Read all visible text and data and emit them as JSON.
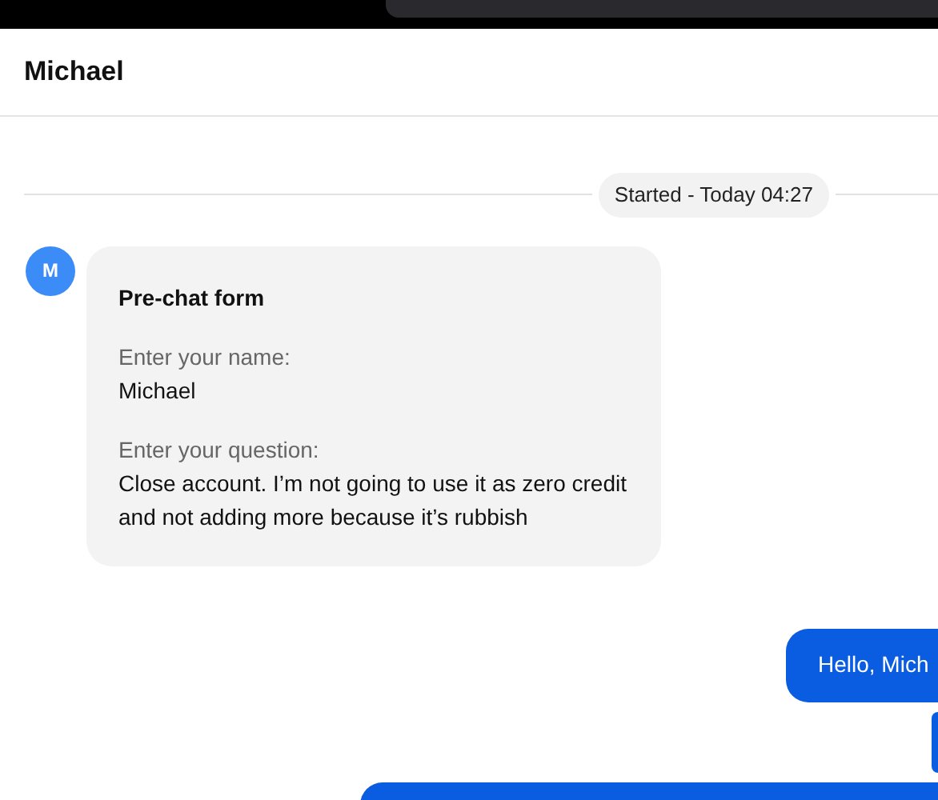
{
  "top_bar": {
    "search": {
      "kind": "field"
    }
  },
  "header": {
    "title": "Michael"
  },
  "separator": {
    "label": "Started - Today 04:27"
  },
  "messages": [
    {
      "kind": "form",
      "avatar": "M",
      "title": "Pre-chat form",
      "fields": [
        {
          "label": "Enter your name:",
          "value": "Michael"
        },
        {
          "label": "Enter your question:",
          "value": "Close account. I’m not going to use it as zero credit and not adding more because it’s rubbish"
        }
      ]
    },
    {
      "kind": "agent",
      "text": "Hello, Mich"
    },
    {
      "kind": "agent_small"
    },
    {
      "kind": "agent_large"
    }
  ]
}
